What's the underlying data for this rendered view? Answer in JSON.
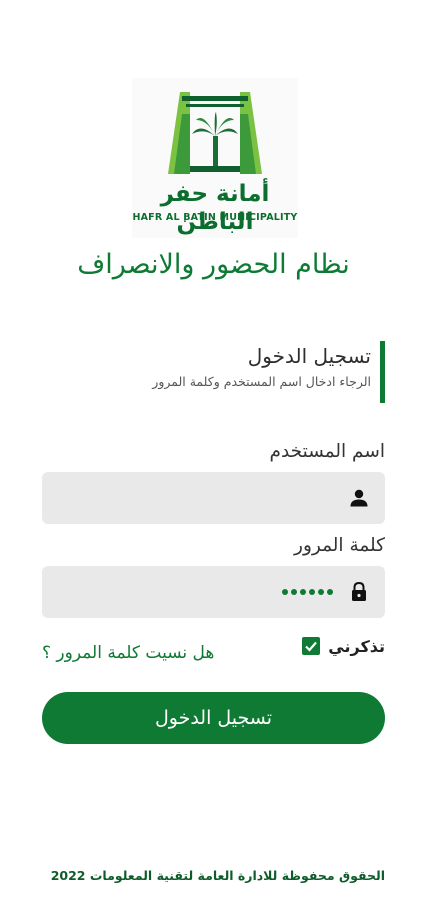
{
  "logo": {
    "arabic_name": "أمانة حفر الباطن",
    "english_name": "HAFR AL BATIN MUNICIPALITY"
  },
  "app_title": "نظام الحضور والانصراف",
  "login": {
    "heading": "تسجيل الدخول",
    "subtitle": "الرجاء ادخال اسم المستخدم وكلمة المرور"
  },
  "username": {
    "label": "اسم المستخدم",
    "value": "",
    "icon": "person-icon"
  },
  "password": {
    "label": "كلمة المرور",
    "masked_length": 6,
    "icon": "lock-icon"
  },
  "remember_me": {
    "label": "تذكرني",
    "checked": true
  },
  "forgot_password": "هل نسيت كلمة المرور ؟",
  "submit_label": "تسجيل الدخول",
  "footer": "الحقوق محفوظة للادارة العامة لتقنية المعلومات 2022",
  "colors": {
    "primary_green": "#0e7a34",
    "field_bg": "#e9e9e9"
  }
}
